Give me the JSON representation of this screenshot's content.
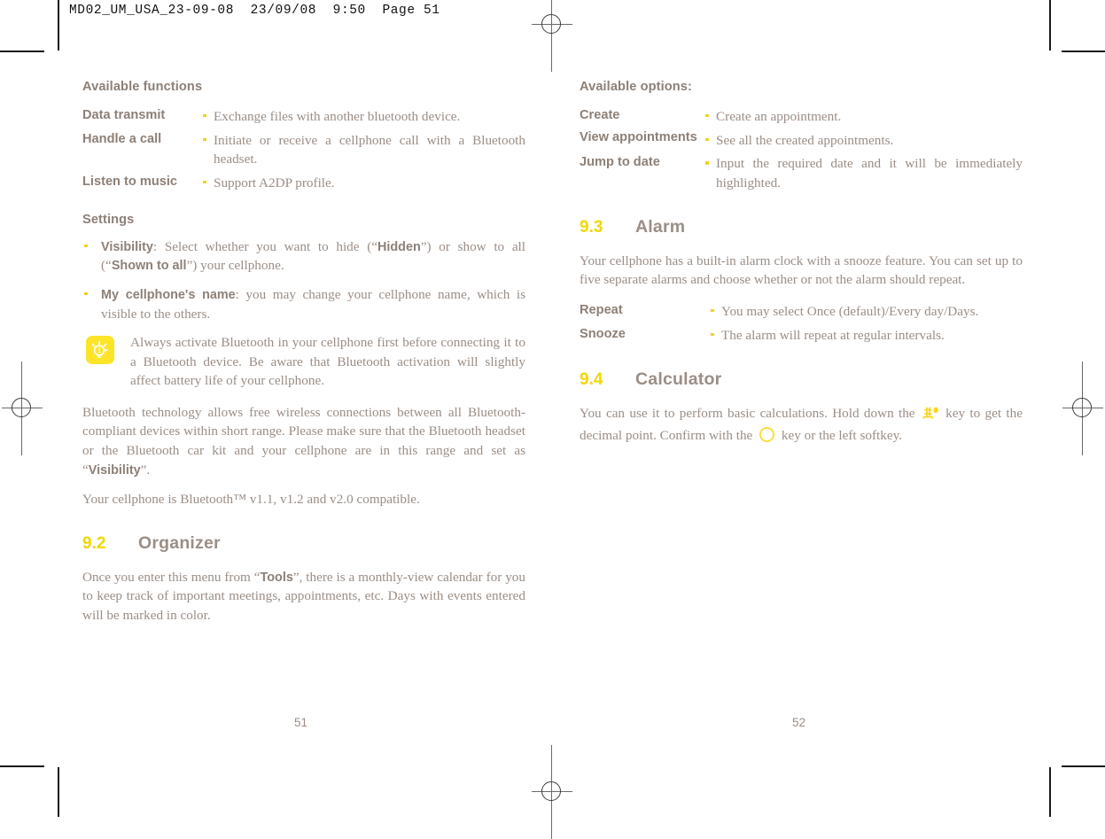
{
  "slug": "MD02_UM_USA_23-09-08  23/09/08  9:50  Page 51",
  "colors": {
    "body_text": "#9b8e86",
    "bold_text": "#8d8077",
    "section_number": "#f2d600",
    "bullet": "#f2d21f",
    "tip_icon_background": "#fde428",
    "key_glyph": "#fadf3c"
  },
  "left_page": {
    "folio": "51",
    "available_functions": {
      "heading": "Available functions",
      "rows": [
        {
          "term": "Data transmit",
          "desc": "Exchange files with another bluetooth device."
        },
        {
          "term": "Handle a call",
          "desc": "Initiate or receive a cellphone call with a Bluetooth headset."
        },
        {
          "term": "Listen to music",
          "desc": "Support A2DP profile."
        }
      ]
    },
    "settings": {
      "heading": "Settings",
      "bullets": [
        {
          "term": "Visibility",
          "text_1": ": Select whether you want to hide (“",
          "strong_1": "Hidden",
          "text_2": "”) or show to all (“",
          "strong_2": "Shown to all",
          "text_3": "”) your cellphone."
        },
        {
          "term": "My cellphone's name",
          "text_1": ": you may change your cellphone name, which is visible to the others.",
          "strong_1": "",
          "text_2": "",
          "strong_2": "",
          "text_3": ""
        }
      ]
    },
    "tip": {
      "icon": "lightbulb-icon",
      "text": "Always activate Bluetooth in your cellphone first before connecting it to a Bluetooth device. Be aware that Bluetooth activation will slightly affect battery life of your cellphone."
    },
    "bluetooth_paragraph": {
      "text_1": "Bluetooth technology allows free wireless connections between all Bluetooth-compliant devices within short range. Please make sure that the Bluetooth headset or the Bluetooth car kit and your cellphone are in this range and set as “",
      "strong_1": "Visibility",
      "text_2": "”."
    },
    "compatibility_paragraph": "Your cellphone is Bluetooth™ v1.1, v1.2 and v2.0 compatible.",
    "organizer": {
      "number": "9.2",
      "title": "Organizer",
      "paragraph": {
        "text_1": "Once you enter this menu from “",
        "strong_1": "Tools",
        "text_2": "”, there is a monthly-view calendar for you to keep track of important meetings, appointments, etc. Days with events entered will be marked in color."
      }
    }
  },
  "right_page": {
    "folio": "52",
    "available_options": {
      "heading": "Available options:",
      "rows": [
        {
          "term": "Create",
          "desc": "Create an appointment."
        },
        {
          "term": "View appointments",
          "desc": "See all the created appointments."
        },
        {
          "term": "Jump to date",
          "desc": "Input the required date and it will be immediately highlighted."
        }
      ]
    },
    "alarm": {
      "number": "9.3",
      "title": "Alarm",
      "paragraph": "Your cellphone has a built-in alarm clock with a snooze feature. You can set up to five separate alarms and choose whether or not the alarm should repeat.",
      "rows": [
        {
          "term": "Repeat",
          "desc": "You may select Once (default)/Every day/Days."
        },
        {
          "term": "Snooze",
          "desc": "The alarm will repeat at regular intervals."
        }
      ]
    },
    "calculator": {
      "number": "9.4",
      "title": "Calculator",
      "paragraph": {
        "text_1": "You can use it to perform basic calculations. Hold down the ",
        "key_1": "hash-key-icon",
        "text_2": " key to get the decimal point. Confirm with the ",
        "key_2": "ok-key-icon",
        "text_3": " key or the left softkey."
      }
    }
  }
}
